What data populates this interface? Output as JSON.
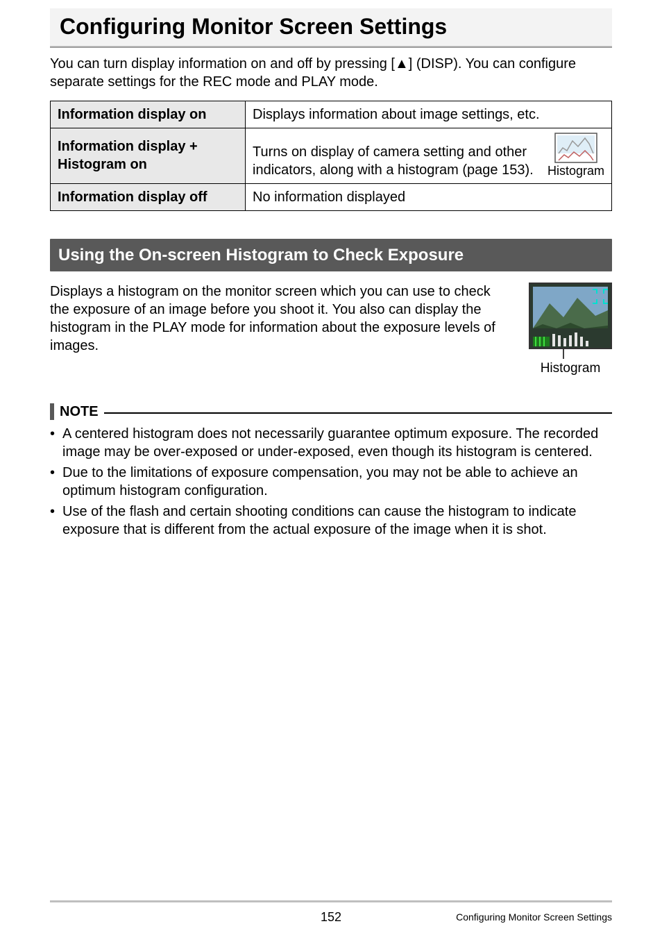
{
  "title": "Configuring Monitor Screen Settings",
  "intro": "You can turn display information on and off by pressing [▲] (DISP). You can configure separate settings for the REC mode and PLAY mode.",
  "table": {
    "row1": {
      "label": "Information display on",
      "desc": "Displays information about image settings, etc."
    },
    "row2": {
      "label": "Information display + Histogram on",
      "desc": "Turns on display of camera setting and other indicators, along with a histogram (page 153).",
      "caption": "Histogram"
    },
    "row3": {
      "label": "Information display off",
      "desc": "No information displayed"
    }
  },
  "section_heading": "Using the On-screen Histogram to Check Exposure",
  "histogram_text": "Displays a histogram on the monitor screen which you can use to check the exposure of an image before you shoot it. You also can display the histogram in the PLAY mode for information about the exposure levels of images.",
  "histogram_caption": "Histogram",
  "note_label": "NOTE",
  "notes": [
    "A centered histogram does not necessarily guarantee optimum exposure. The recorded image may be over-exposed or under-exposed, even though its histogram is centered.",
    "Due to the limitations of exposure compensation, you may not be able to achieve an optimum histogram configuration.",
    "Use of the flash and certain shooting conditions can cause the histogram to indicate exposure that is different from the actual exposure of the image when it is shot."
  ],
  "footer": {
    "page": "152",
    "section": "Configuring Monitor Screen Settings"
  }
}
